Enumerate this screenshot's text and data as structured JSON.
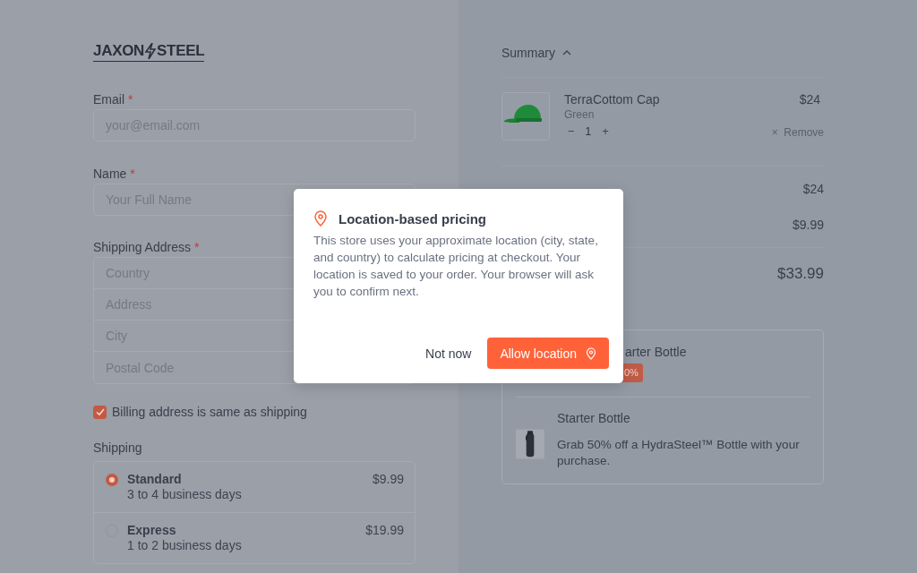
{
  "logo": {
    "parts": [
      "JAXON",
      "STEEL"
    ]
  },
  "form": {
    "email": {
      "label": "Email",
      "required_mark": "*",
      "placeholder": "your@email.com"
    },
    "name": {
      "label": "Name",
      "required_mark": "*",
      "placeholder": "Your Full Name"
    },
    "shipping_address": {
      "label": "Shipping Address",
      "required_mark": "*",
      "placeholders": [
        "Country",
        "Address",
        "City",
        "Postal Code"
      ]
    },
    "billing_same": {
      "label": "Billing address is same as shipping",
      "checked": true
    },
    "shipping": {
      "label": "Shipping",
      "options": [
        {
          "name": "Standard",
          "detail": "3 to 4 business days",
          "price": "$9.99",
          "selected": true
        },
        {
          "name": "Express",
          "detail": "1 to 2 business days",
          "price": "$19.99",
          "selected": false
        }
      ]
    }
  },
  "summary": {
    "title": "Summary",
    "expanded": true,
    "items": [
      {
        "name": "TerraCottom Cap",
        "variant": "Green",
        "quantity": "1",
        "price": "$24",
        "remove": "Remove",
        "decrement": "−",
        "increment": "+",
        "remove_icon": "×"
      }
    ],
    "totals": [
      {
        "kind": "row",
        "value": "$24"
      },
      {
        "kind": "row",
        "value": "$9.99"
      },
      {
        "kind": "total",
        "value": "$33.99"
      }
    ],
    "upsell": [
      {
        "kind": "partial",
        "title": "arter Bottle",
        "badge": "0%"
      },
      {
        "kind": "full",
        "title": "Starter Bottle",
        "description": "Grab 50% off a HydraSteel™ Bottle with your purchase."
      }
    ]
  },
  "modal": {
    "title": "Location-based pricing",
    "body": "This store uses your approximate location (city, state, and country) to calculate pricing at checkout. Your location is saved to your order. Your browser will ask you to confirm next.",
    "buttons": [
      {
        "kind": "secondary",
        "label": "Not now"
      },
      {
        "kind": "primary",
        "label": "Allow location"
      }
    ]
  }
}
